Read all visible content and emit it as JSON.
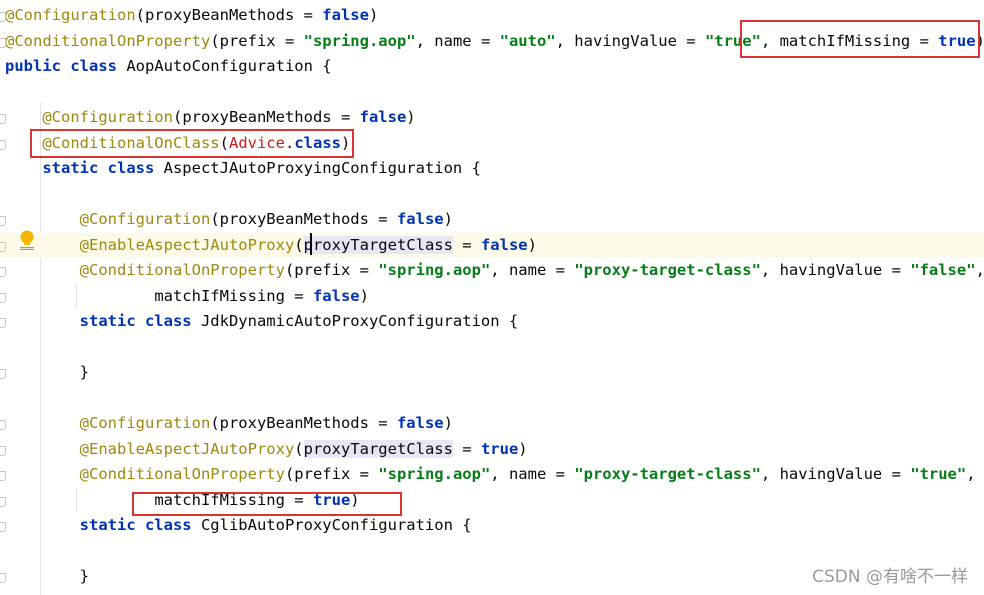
{
  "editor": {
    "lines": [
      {
        "segments": [
          {
            "t": "@Configuration",
            "c": "ann"
          },
          {
            "t": "(proxyBeanMethods = ",
            "c": ""
          },
          {
            "t": "false",
            "c": "kw"
          },
          {
            "t": ")",
            "c": ""
          }
        ]
      },
      {
        "segments": [
          {
            "t": "@ConditionalOnProperty",
            "c": "ann"
          },
          {
            "t": "(prefix = ",
            "c": ""
          },
          {
            "t": "\"spring.aop\"",
            "c": "str"
          },
          {
            "t": ", name = ",
            "c": ""
          },
          {
            "t": "\"auto\"",
            "c": "str"
          },
          {
            "t": ", havingValue = ",
            "c": ""
          },
          {
            "t": "\"true\"",
            "c": "str"
          },
          {
            "t": ", matchIfMissing = ",
            "c": ""
          },
          {
            "t": "true",
            "c": "kw"
          },
          {
            "t": ")",
            "c": ""
          }
        ]
      },
      {
        "segments": [
          {
            "t": "public class",
            "c": "kw"
          },
          {
            "t": " AopAutoConfiguration {",
            "c": ""
          }
        ]
      },
      {
        "segments": []
      },
      {
        "segments": [
          {
            "t": "    ",
            "c": ""
          },
          {
            "t": "@Configuration",
            "c": "ann"
          },
          {
            "t": "(proxyBeanMethods = ",
            "c": ""
          },
          {
            "t": "false",
            "c": "kw"
          },
          {
            "t": ")",
            "c": ""
          }
        ]
      },
      {
        "segments": [
          {
            "t": "    ",
            "c": ""
          },
          {
            "t": "@ConditionalOnClass",
            "c": "ann"
          },
          {
            "t": "(",
            "c": ""
          },
          {
            "t": "Advice",
            "c": "red"
          },
          {
            "t": ".",
            "c": ""
          },
          {
            "t": "class",
            "c": "kw"
          },
          {
            "t": ")",
            "c": ""
          }
        ]
      },
      {
        "segments": [
          {
            "t": "    ",
            "c": ""
          },
          {
            "t": "static class",
            "c": "kw"
          },
          {
            "t": " AspectJAutoProxyingConfiguration {",
            "c": ""
          }
        ]
      },
      {
        "segments": []
      },
      {
        "segments": [
          {
            "t": "        ",
            "c": ""
          },
          {
            "t": "@Configuration",
            "c": "ann"
          },
          {
            "t": "(proxyBeanMethods = ",
            "c": ""
          },
          {
            "t": "false",
            "c": "kw"
          },
          {
            "t": ")",
            "c": ""
          }
        ]
      },
      {
        "segments": [
          {
            "t": "        ",
            "c": ""
          },
          {
            "t": "@EnableAspectJAutoProxy",
            "c": "ann"
          },
          {
            "t": "(",
            "c": ""
          },
          {
            "t": "proxyTargetClass",
            "c": "param-hl"
          },
          {
            "t": " = ",
            "c": ""
          },
          {
            "t": "false",
            "c": "kw"
          },
          {
            "t": ")",
            "c": ""
          }
        ]
      },
      {
        "segments": [
          {
            "t": "        ",
            "c": ""
          },
          {
            "t": "@ConditionalOnProperty",
            "c": "ann"
          },
          {
            "t": "(prefix = ",
            "c": ""
          },
          {
            "t": "\"spring.aop\"",
            "c": "str"
          },
          {
            "t": ", name = ",
            "c": ""
          },
          {
            "t": "\"proxy-target-class\"",
            "c": "str"
          },
          {
            "t": ", havingValue = ",
            "c": ""
          },
          {
            "t": "\"false\"",
            "c": "str"
          },
          {
            "t": ",",
            "c": ""
          }
        ]
      },
      {
        "segments": [
          {
            "t": "                ",
            "c": ""
          },
          {
            "t": "matchIfMissing = ",
            "c": ""
          },
          {
            "t": "false",
            "c": "kw"
          },
          {
            "t": ")",
            "c": ""
          }
        ]
      },
      {
        "segments": [
          {
            "t": "        ",
            "c": ""
          },
          {
            "t": "static class",
            "c": "kw"
          },
          {
            "t": " JdkDynamicAutoProxyConfiguration {",
            "c": ""
          }
        ]
      },
      {
        "segments": []
      },
      {
        "segments": [
          {
            "t": "        }",
            "c": ""
          }
        ]
      },
      {
        "segments": []
      },
      {
        "segments": [
          {
            "t": "        ",
            "c": ""
          },
          {
            "t": "@Configuration",
            "c": "ann"
          },
          {
            "t": "(proxyBeanMethods = ",
            "c": ""
          },
          {
            "t": "false",
            "c": "kw"
          },
          {
            "t": ")",
            "c": ""
          }
        ]
      },
      {
        "segments": [
          {
            "t": "        ",
            "c": ""
          },
          {
            "t": "@EnableAspectJAutoProxy",
            "c": "ann"
          },
          {
            "t": "(",
            "c": ""
          },
          {
            "t": "proxyTargetClass",
            "c": "param-hl"
          },
          {
            "t": " = ",
            "c": ""
          },
          {
            "t": "true",
            "c": "kw"
          },
          {
            "t": ")",
            "c": ""
          }
        ]
      },
      {
        "segments": [
          {
            "t": "        ",
            "c": ""
          },
          {
            "t": "@ConditionalOnProperty",
            "c": "ann"
          },
          {
            "t": "(prefix = ",
            "c": ""
          },
          {
            "t": "\"spring.aop\"",
            "c": "str"
          },
          {
            "t": ", name = ",
            "c": ""
          },
          {
            "t": "\"proxy-target-class\"",
            "c": "str"
          },
          {
            "t": ", havingValue = ",
            "c": ""
          },
          {
            "t": "\"true\"",
            "c": "str"
          },
          {
            "t": ",",
            "c": ""
          }
        ]
      },
      {
        "segments": [
          {
            "t": "                ",
            "c": ""
          },
          {
            "t": "matchIfMissing = ",
            "c": ""
          },
          {
            "t": "true",
            "c": "kw"
          },
          {
            "t": ")",
            "c": ""
          }
        ]
      },
      {
        "segments": [
          {
            "t": "        ",
            "c": ""
          },
          {
            "t": "static class",
            "c": "kw"
          },
          {
            "t": " CglibAutoProxyConfiguration {",
            "c": ""
          }
        ]
      },
      {
        "segments": []
      },
      {
        "segments": [
          {
            "t": "        }",
            "c": ""
          }
        ]
      }
    ]
  },
  "highlight_color": "#e03131",
  "watermark": "CSDN @有啥不一样"
}
